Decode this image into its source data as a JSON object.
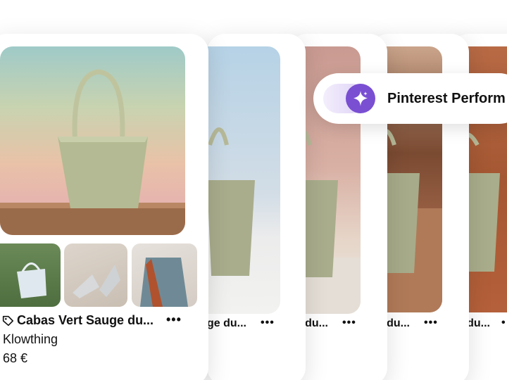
{
  "pill": {
    "label": "Pinterest Perform",
    "icon": "sparkle-icon",
    "accent": "#7a4fd2"
  },
  "main_card": {
    "title": "Cabas Vert Sauge du...",
    "merchant": "Klowthing",
    "price": "68 €",
    "more": "•••"
  },
  "stack_cards": [
    {
      "title": "ge du...",
      "more": "•••"
    },
    {
      "title": "ge du...",
      "more": "•••"
    },
    {
      "title": "ge du...",
      "more": "•••"
    },
    {
      "title": "ge du...",
      "more": "•"
    }
  ]
}
